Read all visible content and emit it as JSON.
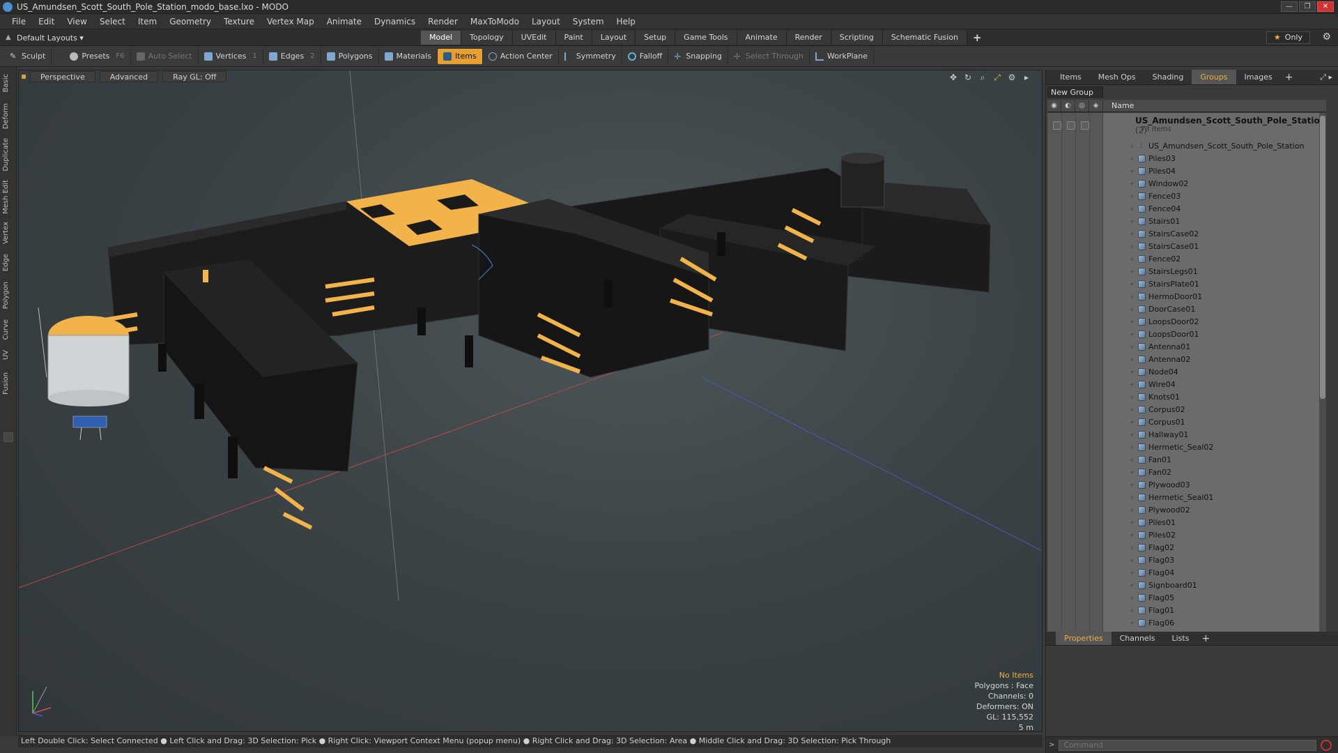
{
  "window": {
    "title": "US_Amundsen_Scott_South_Pole_Station_modo_base.lxo - MODO",
    "controls": [
      "—",
      "❐",
      "✕"
    ]
  },
  "menu": [
    "File",
    "Edit",
    "View",
    "Select",
    "Item",
    "Geometry",
    "Texture",
    "Vertex Map",
    "Animate",
    "Dynamics",
    "Render",
    "MaxToModo",
    "Layout",
    "System",
    "Help"
  ],
  "layout": {
    "preset": "Default Layouts ▾",
    "tabs": [
      "Model",
      "Topology",
      "UVEdit",
      "Paint",
      "Layout",
      "Setup",
      "Game Tools",
      "Animate",
      "Render",
      "Scripting",
      "Schematic Fusion"
    ],
    "active_tab": "Model",
    "add_tab": "+",
    "only_label": "Only"
  },
  "toolbar": {
    "sculpt": "Sculpt",
    "presets": "Presets",
    "presets_key": "F6",
    "auto_select": "Auto Select",
    "vertices": "Vertices",
    "vertices_count": "1",
    "edges": "Edges",
    "edges_count": "2",
    "polygons": "Polygons",
    "materials": "Materials",
    "items": "Items",
    "action_center": "Action Center",
    "symmetry": "Symmetry",
    "falloff": "Falloff",
    "snapping": "Snapping",
    "select_through": "Select Through",
    "workplane": "WorkPlane"
  },
  "left_tabs": [
    "Basic",
    "Deform",
    "Duplicate",
    "Mesh Edit",
    "Vertex",
    "Edge",
    "Polygon",
    "Curve",
    "UV",
    "Fusion"
  ],
  "viewport": {
    "view": "Perspective",
    "shading": "Advanced",
    "raygl": "Ray GL: Off",
    "info": {
      "items": "No Items",
      "polygons": "Polygons : Face",
      "channels": "Channels: 0",
      "deformers": "Deformers: ON",
      "gl": "GL: 115,552",
      "scale": "5 m"
    }
  },
  "status": "Left Double Click: Select Connected ● Left Click and Drag: 3D Selection: Pick ● Right Click: Viewport Context Menu (popup menu) ● Right Click and Drag: 3D Selection: Area ● Middle Click and Drag: 3D Selection: Pick Through",
  "right_panel": {
    "tabs": [
      "Items",
      "Mesh Ops",
      "Shading",
      "Groups",
      "Images"
    ],
    "active_tab": "Groups",
    "new_group": "New Group",
    "column_name": "Name",
    "group": {
      "name": "US_Amundsen_Scott_South_Pole_Station",
      "count": "(2)",
      "subtitle": "73 Items"
    },
    "items": [
      "US_Amundsen_Scott_South_Pole_Station",
      "Piles03",
      "Piles04",
      "Window02",
      "Fence03",
      "Fence04",
      "Stairs01",
      "StairsCase02",
      "StairsCase01",
      "Fence02",
      "StairsLegs01",
      "StairsPlate01",
      "HermoDoor01",
      "DoorCase01",
      "LoopsDoor02",
      "LoopsDoor01",
      "Antenna01",
      "Antenna02",
      "Node04",
      "Wire04",
      "Knots01",
      "Corpus02",
      "Corpus01",
      "Hallway01",
      "Hermetic_Seal02",
      "Fan01",
      "Fan02",
      "Plywood03",
      "Hermetic_Seal01",
      "Plywood02",
      "Piles01",
      "Piles02",
      "Flag02",
      "Flag03",
      "Flag04",
      "Signboard01",
      "Flag05",
      "Flag01",
      "Flag06"
    ],
    "bottom_tabs": [
      "Properties",
      "Channels",
      "Lists"
    ],
    "bottom_active": "Properties",
    "command_placeholder": "Command"
  },
  "colors": {
    "accent": "#e6a030",
    "highlight_yellow": "#f0b040"
  }
}
